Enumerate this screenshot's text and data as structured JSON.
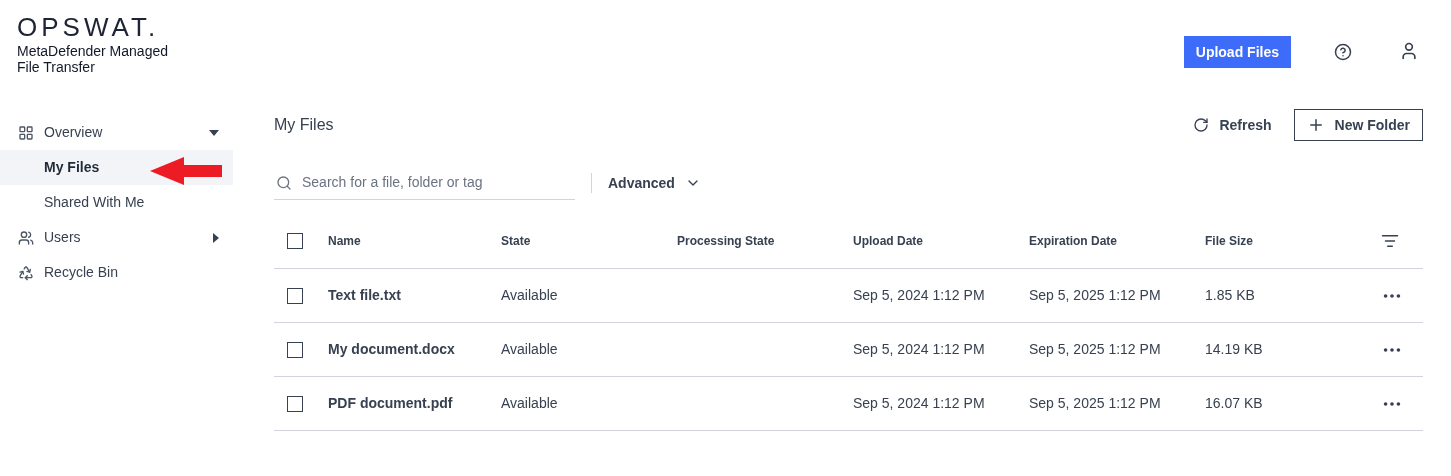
{
  "header": {
    "logo": "OPSWAT.",
    "product": "MetaDefender Managed File Transfer",
    "upload_button": "Upload Files"
  },
  "sidebar": {
    "items": [
      {
        "label": "Overview",
        "expanded": true,
        "selected": false,
        "children": [
          {
            "label": "My Files",
            "selected": true
          },
          {
            "label": "Shared With Me",
            "selected": false
          }
        ]
      },
      {
        "label": "Users",
        "expanded": false,
        "selected": false
      },
      {
        "label": "Recycle Bin",
        "selected": false
      }
    ]
  },
  "main": {
    "title": "My Files",
    "refresh": "Refresh",
    "new_folder": "New Folder",
    "search": {
      "placeholder": "Search for a file, folder or tag"
    },
    "advanced": "Advanced",
    "table": {
      "columns": [
        "Name",
        "State",
        "Processing State",
        "Upload Date",
        "Expiration Date",
        "File Size"
      ],
      "all_checked": false,
      "rows": [
        {
          "checked": false,
          "cells": [
            "Text file.txt",
            "Available",
            "",
            "Sep 5, 2024 1:12 PM",
            "Sep 5, 2025 1:12 PM",
            "1.85 KB"
          ]
        },
        {
          "checked": false,
          "cells": [
            "My document.docx",
            "Available",
            "",
            "Sep 5, 2024 1:12 PM",
            "Sep 5, 2025 1:12 PM",
            "14.19 KB"
          ]
        },
        {
          "checked": false,
          "cells": [
            "PDF document.pdf",
            "Available",
            "",
            "Sep 5, 2024 1:12 PM",
            "Sep 5, 2025 1:12 PM",
            "16.07 KB"
          ]
        }
      ]
    }
  }
}
